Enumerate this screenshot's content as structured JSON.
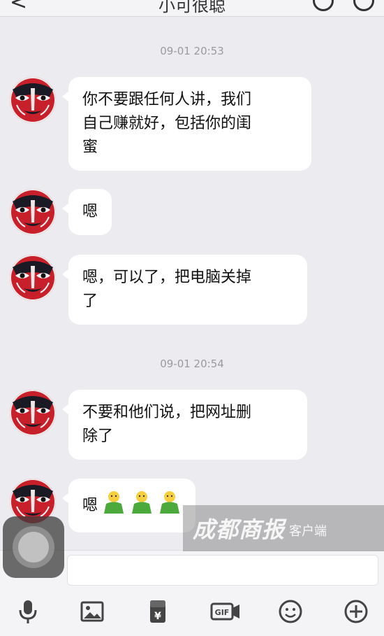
{
  "header": {
    "title": "小可很聪",
    "back_glyph": "<"
  },
  "messages": [
    {
      "timestamp": "09-01 20:53",
      "text": "你不要跟任何人讲，我们\n自己赚就好，包括你的闺\n蜜"
    },
    {
      "text": "嗯"
    },
    {
      "text": "嗯，可以了，把电脑关掉\n了"
    },
    {
      "timestamp": "09-01 20:54",
      "text": "不要和他们说，把网址删\n除了"
    },
    {
      "text": "嗯",
      "emoji": [
        "person-emoji",
        "person-emoji",
        "person-emoji"
      ]
    }
  ],
  "watermark": {
    "main": "成都商报",
    "sub": "客户端"
  },
  "toolbar": {
    "items": [
      "microphone-icon",
      "image-icon",
      "red-packet-icon",
      "gif-icon",
      "emoji-face-icon",
      "plus-icon"
    ],
    "gif_label": "GIF",
    "red_packet_label": "¥"
  },
  "colors": {
    "background": "#ebebf0",
    "bubble": "#ffffff",
    "avatar_red": "#c8202a",
    "icon_gray": "#444444"
  }
}
